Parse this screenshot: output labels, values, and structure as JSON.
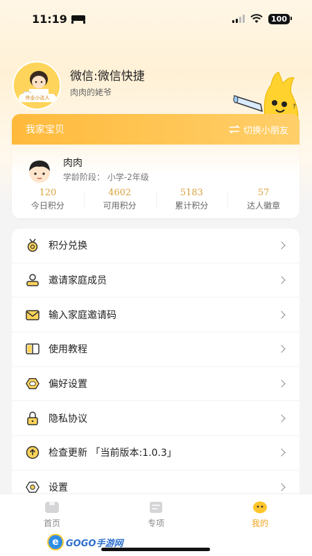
{
  "status_bar": {
    "time": "11:19",
    "battery": "100"
  },
  "profile": {
    "badge": "作业小达人",
    "name": "微信:微信快捷",
    "relation": "肉肉的姥爷"
  },
  "family": {
    "title": "我家宝贝",
    "switch_label": "切换小朋友",
    "child_name": "肉肉",
    "stage_label": "学龄阶段：",
    "stage_value": "小学-2年级",
    "stats": [
      {
        "value": "120",
        "label": "今日积分"
      },
      {
        "value": "4602",
        "label": "可用积分"
      },
      {
        "value": "5183",
        "label": "累计积分"
      },
      {
        "value": "57",
        "label": "达人徽章"
      }
    ]
  },
  "menu": [
    {
      "label": "积分兑换",
      "icon": "medal-icon"
    },
    {
      "label": "邀请家庭成员",
      "icon": "invite-icon"
    },
    {
      "label": "输入家庭邀请码",
      "icon": "envelope-icon"
    },
    {
      "label": "使用教程",
      "icon": "book-icon"
    },
    {
      "label": "偏好设置",
      "icon": "diamond-icon"
    },
    {
      "label": "隐私协议",
      "icon": "lock-icon"
    },
    {
      "label": "检查更新 「当前版本:1.0.3」",
      "icon": "update-icon"
    },
    {
      "label": "设置",
      "icon": "settings-icon"
    }
  ],
  "tabs": [
    {
      "label": "首页",
      "icon": "home-icon"
    },
    {
      "label": "专项",
      "icon": "topic-icon"
    },
    {
      "label": "我的",
      "icon": "mine-icon"
    }
  ],
  "active_tab": "我的",
  "watermark": "GOGO手游网",
  "colors": {
    "accent": "#ffba3c",
    "stat_value": "#d8a23a",
    "active_tab": "#f0a61f"
  }
}
